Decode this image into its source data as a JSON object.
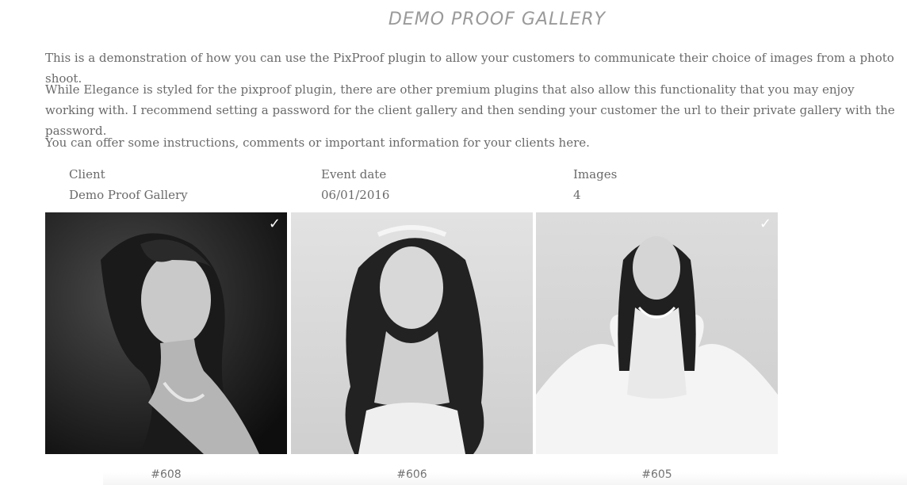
{
  "page": {
    "title": "DEMO PROOF GALLERY",
    "paragraphs": [
      "This is a demonstration of how you can use the PixProof plugin to allow your customers to communicate their choice of images from a photo shoot.",
      "While Elegance is styled for the pixproof plugin, there are other premium plugins that also allow this functionality that you may enjoy working with.  I recommend setting a password for the client gallery and then sending your customer the url to their private gallery with the password.",
      "You can offer some instructions, comments or important information for your clients here."
    ]
  },
  "meta": {
    "client_label": "Client",
    "client_value": "Demo Proof Gallery",
    "date_label": "Event date",
    "date_value": "06/01/2016",
    "images_label": "Images",
    "images_value": "4"
  },
  "gallery": [
    {
      "caption": "#608",
      "selected": true,
      "check": "✓",
      "icon": "portrait-photo"
    },
    {
      "caption": "#606",
      "selected": false,
      "check": "",
      "icon": "portrait-photo"
    },
    {
      "caption": "#605",
      "selected": true,
      "check": "✓",
      "icon": "portrait-photo"
    }
  ]
}
